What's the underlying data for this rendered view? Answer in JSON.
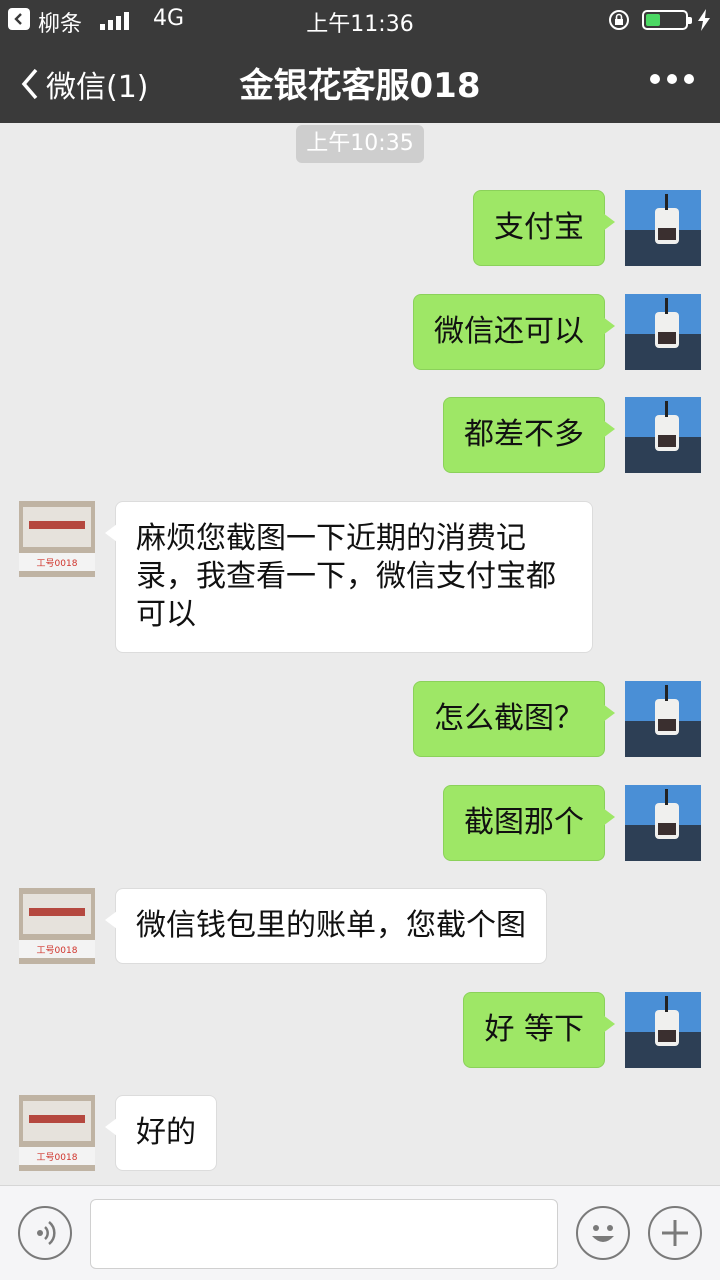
{
  "status_bar": {
    "back_app": "柳条",
    "network": "4G",
    "time": "上午11:36"
  },
  "nav": {
    "back_label": "微信(1)",
    "title": "金银花客服018"
  },
  "chat": {
    "timestamp": "上午10:35",
    "messages": [
      {
        "from": "me",
        "text": "支付宝"
      },
      {
        "from": "me",
        "text": "微信还可以"
      },
      {
        "from": "me",
        "text": "都差不多"
      },
      {
        "from": "them",
        "text": "麻烦您截图一下近期的消费记录，我查看一下，微信支付宝都可以"
      },
      {
        "from": "me",
        "text": "怎么截图？"
      },
      {
        "from": "me",
        "text": "截图那个"
      },
      {
        "from": "them",
        "text": "微信钱包里的账单，您截个图"
      },
      {
        "from": "me",
        "text": "好 等下"
      },
      {
        "from": "them",
        "text": "好的"
      }
    ],
    "agent_badge": "工号0018"
  },
  "input": {
    "placeholder": ""
  }
}
